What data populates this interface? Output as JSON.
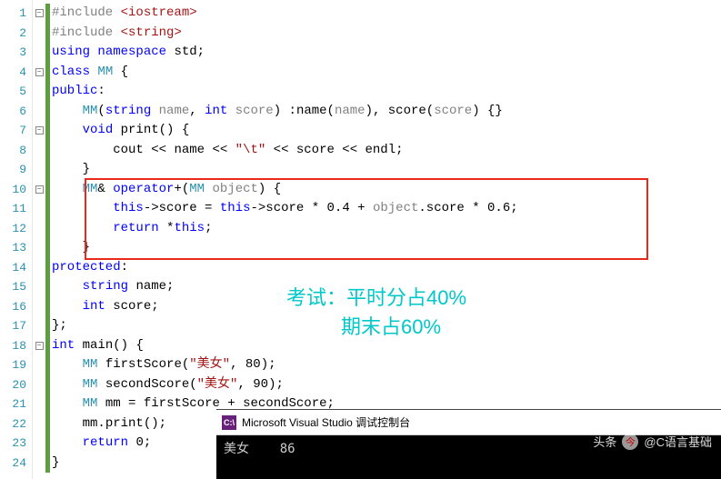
{
  "lines": [
    "1",
    "2",
    "3",
    "4",
    "5",
    "6",
    "7",
    "8",
    "9",
    "10",
    "11",
    "12",
    "13",
    "14",
    "15",
    "16",
    "17",
    "18",
    "19",
    "20",
    "21",
    "22",
    "23",
    "24"
  ],
  "code": {
    "l1": {
      "pre": "#include",
      "ang": "<iostream>"
    },
    "l2": {
      "pre": "#include",
      "ang": "<string>"
    },
    "l3": {
      "kw1": "using",
      "kw2": "namespace",
      "id": "std",
      "p": ";"
    },
    "l4": {
      "kw": "class",
      "type": "MM",
      "p": " {"
    },
    "l5": {
      "kw": "public",
      "p": ":"
    },
    "l6": {
      "type": "MM",
      "p1": "(",
      "t2": "string",
      "a1": "name",
      "c1": ",",
      "t3": "int",
      "a2": "score",
      "p2": ") :",
      "m1": "name",
      "p3": "(",
      "r1": "name",
      "p4": "),",
      "m2": "score",
      "p5": "(",
      "r2": "score",
      "p6": ") {}"
    },
    "l7": {
      "kw": "void",
      "fn": "print",
      "p": "() {"
    },
    "l8": {
      "id1": "cout",
      "op1": " << ",
      "id2": "name",
      "op2": " << ",
      "str": "\"\\t\"",
      "op3": " << ",
      "id3": "score",
      "op4": " << ",
      "id4": "endl",
      "p": ";"
    },
    "l9": {
      "p": "}"
    },
    "l10": {
      "type": "MM",
      "amp": "& ",
      "kw": "operator",
      "op": "+",
      "p1": "(",
      "t2": "MM",
      "a1": "object",
      "p2": ") {"
    },
    "l11": {
      "kw1": "this",
      "op1": "->",
      "m1": "score",
      "op2": " = ",
      "kw2": "this",
      "op3": "->",
      "m2": "score",
      "op4": " * ",
      "n1": "0.4",
      "op5": " + ",
      "obj": "object",
      "op6": ".",
      "m3": "score",
      "op7": " * ",
      "n2": "0.6",
      "p": ";"
    },
    "l12": {
      "kw": "return",
      "op": " *",
      "kw2": "this",
      "p": ";"
    },
    "l13": {
      "p": "}"
    },
    "l14": {
      "kw": "protected",
      "p": ":"
    },
    "l15": {
      "t": "string",
      "id": "name",
      "p": ";"
    },
    "l16": {
      "t": "int",
      "id": "score",
      "p": ";"
    },
    "l17": {
      "p": "};"
    },
    "l18": {
      "t": "int",
      "fn": "main",
      "p": "() {"
    },
    "l19": {
      "type": "MM",
      "id": "firstScore",
      "p1": "(",
      "str": "\"美女\"",
      "c": ",",
      "n": "80",
      "p2": ");"
    },
    "l20": {
      "type": "MM",
      "id": "secondScore",
      "p1": "(",
      "str": "\"美女\"",
      "c": ",",
      "n": "90",
      "p2": ");"
    },
    "l21": {
      "type": "MM",
      "id": "mm",
      "op": " = ",
      "id2": "firstScore",
      "op2": " + ",
      "id3": "secondScore",
      "p": ";"
    },
    "l22": {
      "id": "mm",
      "op": ".",
      "fn": "print",
      "p": "();"
    },
    "l23": {
      "kw": "return",
      "n": "0",
      "p": ";"
    },
    "l24": {
      "p": "}"
    }
  },
  "annotation": {
    "line1": "考试：平时分占40%",
    "line2": "期末占60%"
  },
  "console": {
    "title": "Microsoft Visual Studio 调试控制台",
    "icon": "C:\\",
    "output": "美女    86"
  },
  "watermark": {
    "prefix": "头条",
    "author": "@C语言基础"
  }
}
